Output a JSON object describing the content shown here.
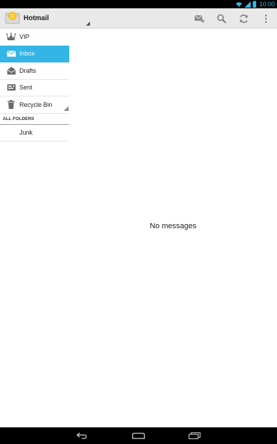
{
  "status_bar": {
    "time": "10:00",
    "icons": [
      "wifi-icon",
      "signal-icon",
      "battery-icon"
    ]
  },
  "action_bar": {
    "account_name": "Hotmail",
    "actions": [
      "compose-icon",
      "search-icon",
      "refresh-icon",
      "overflow-menu-icon"
    ]
  },
  "drawer": {
    "items": [
      {
        "label": "VIP",
        "icon": "crown-icon",
        "active": false
      },
      {
        "label": "Inbox",
        "icon": "inbox-icon",
        "active": true
      },
      {
        "label": "Drafts",
        "icon": "drafts-icon",
        "active": false
      },
      {
        "label": "Sent",
        "icon": "sent-icon",
        "active": false
      },
      {
        "label": "Recycle Bin",
        "icon": "trash-icon",
        "active": false
      }
    ],
    "section_header": "ALL FOLDERS",
    "folders": [
      {
        "label": "Junk"
      }
    ]
  },
  "main": {
    "empty_message": "No messages"
  },
  "nav_bar": {
    "buttons": [
      "back-icon",
      "home-icon",
      "recent-apps-icon"
    ]
  },
  "colors": {
    "accent": "#33b5e5",
    "action_bar_bg": "#e9e9e9"
  }
}
